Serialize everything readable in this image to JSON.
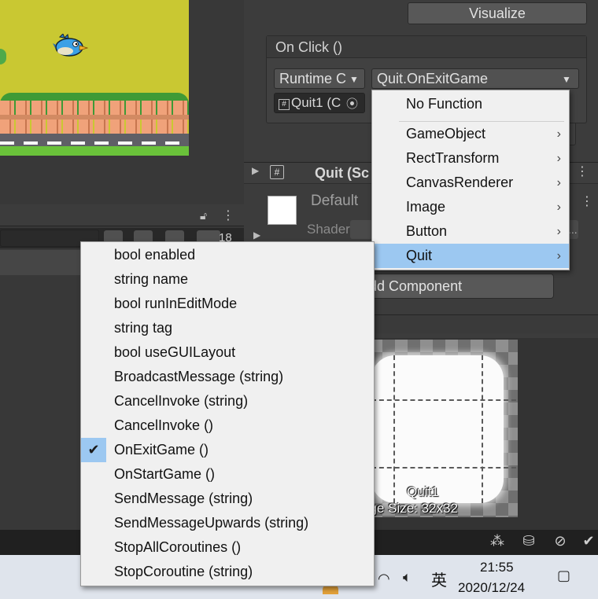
{
  "inspector": {
    "visualize_label": "Visualize",
    "onclick_title": "On Click ()",
    "runtime_value": "Runtime C",
    "function_value": "Quit.OnExitGame",
    "object_value": "Quit1 (C",
    "component_title": "Quit (Sc",
    "material_name": "Default",
    "shader_label": "Shader",
    "shader_ellipsis": "...",
    "add_component_label": "dd Component"
  },
  "hierarchy": {
    "visible_count": "18"
  },
  "preview": {
    "sprite_name": "Quit1",
    "image_size": "age Size: 32x32"
  },
  "function_menu": {
    "items": [
      {
        "label": "No Function"
      },
      {
        "label": "GameObject"
      },
      {
        "label": "RectTransform"
      },
      {
        "label": "CanvasRenderer"
      },
      {
        "label": "Image"
      },
      {
        "label": "Button"
      },
      {
        "label": "Quit"
      }
    ],
    "highlighted": "Quit"
  },
  "method_menu": {
    "items": [
      {
        "label": "bool enabled"
      },
      {
        "label": "string name"
      },
      {
        "label": "bool runInEditMode"
      },
      {
        "label": "string tag"
      },
      {
        "label": "bool useGUILayout"
      },
      {
        "label": "BroadcastMessage (string)"
      },
      {
        "label": "CancelInvoke (string)"
      },
      {
        "label": "CancelInvoke ()"
      },
      {
        "label": "OnExitGame ()"
      },
      {
        "label": "OnStartGame ()"
      },
      {
        "label": "SendMessage (string)"
      },
      {
        "label": "SendMessageUpwards (string)"
      },
      {
        "label": "StopAllCoroutines ()"
      },
      {
        "label": "StopCoroutine (string)"
      }
    ],
    "checked": "OnExitGame ()"
  },
  "taskbar": {
    "ime": "英",
    "time": "21:55",
    "date": "2020/12/24"
  },
  "icons": {
    "check": "check-icon",
    "chevron": "chevron-right-icon",
    "dropdown": "triangle-down-icon"
  },
  "colors": {
    "editor_bg": "#383838",
    "menu_bg": "#f0f0f0",
    "menu_highlight": "#9cc8f1",
    "taskbar_bg": "#dfe4ec"
  }
}
